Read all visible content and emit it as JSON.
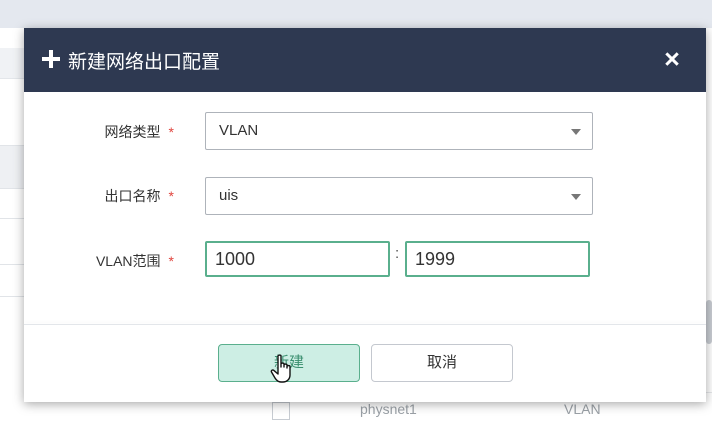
{
  "dialog": {
    "title": "新建网络出口配置",
    "close_label": "×"
  },
  "form": {
    "network_type": {
      "label": "网络类型",
      "required_mark": "*",
      "value": "VLAN"
    },
    "exit_name": {
      "label": "出口名称",
      "required_mark": "*",
      "value": "uis"
    },
    "vlan_range": {
      "label": "VLAN范围",
      "required_mark": "*",
      "start": "1000",
      "separator": ":",
      "end": "1999"
    }
  },
  "buttons": {
    "create": "新建",
    "cancel": "取消"
  },
  "background_table": {
    "row": {
      "name": "physnet1",
      "type": "VLAN"
    }
  }
}
